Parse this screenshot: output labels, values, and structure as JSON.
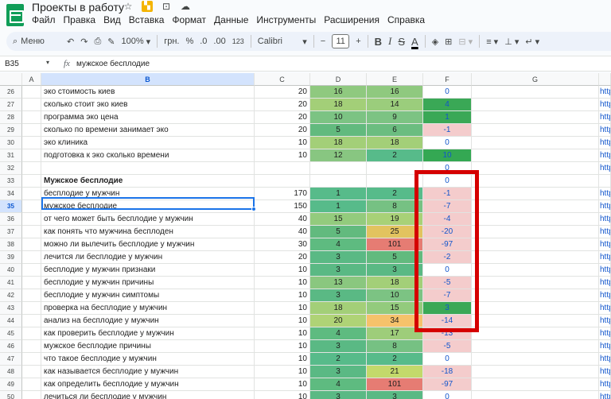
{
  "app": {
    "title": "Проекты в работу",
    "menu": [
      "Файл",
      "Правка",
      "Вид",
      "Вставка",
      "Формат",
      "Данные",
      "Инструменты",
      "Расширения",
      "Справка"
    ]
  },
  "toolbar": {
    "search_label": "Меню",
    "zoom": "100%",
    "currency": "грн.",
    "percent": "%",
    "dec_less": ".0",
    "dec_more": ".00",
    "format_123": "123",
    "font": "Calibri",
    "font_size": "11",
    "bold": "B",
    "italic": "I",
    "strike": "S",
    "text_color": "A"
  },
  "formula_bar": {
    "cell_ref": "B35",
    "fx": "fx",
    "value": "мужское бесплодие"
  },
  "columns": [
    "A",
    "B",
    "C",
    "D",
    "E",
    "F",
    "G"
  ],
  "selected_column": "B",
  "selected_row": "35",
  "rows": [
    {
      "num": "26",
      "b": "эко стоимость киев",
      "c": "20",
      "d": "16",
      "e": "16",
      "f": "0",
      "h": "http",
      "dc": "#8fc97f",
      "ec": "#8fc97f",
      "fc": ""
    },
    {
      "num": "27",
      "b": "сколько стоит эко киев",
      "c": "20",
      "d": "18",
      "e": "14",
      "f": "4",
      "h": "http",
      "dc": "#a3cf78",
      "ec": "#9bcd7c",
      "fc": "#3aa856"
    },
    {
      "num": "28",
      "b": "программа эко цена",
      "c": "20",
      "d": "10",
      "e": "9",
      "f": "1",
      "h": "http",
      "dc": "#7cc383",
      "ec": "#7cc383",
      "fc": "#3aa856"
    },
    {
      "num": "29",
      "b": "сколько по времени занимает эко",
      "c": "20",
      "d": "5",
      "e": "6",
      "f": "-1",
      "h": "http",
      "dc": "#62ba7e",
      "ec": "#6bbd80",
      "fc": "#f4cccc"
    },
    {
      "num": "30",
      "b": "эко клиника",
      "c": "10",
      "d": "18",
      "e": "18",
      "f": "0",
      "h": "http",
      "dc": "#a3cf78",
      "ec": "#a3cf78",
      "fc": ""
    },
    {
      "num": "31",
      "b": "подготовка к эко сколько времени",
      "c": "10",
      "d": "12",
      "e": "2",
      "f": "10",
      "h": "http",
      "dc": "#88c681",
      "ec": "#57bb8a",
      "fc": "#34a853"
    },
    {
      "num": "32",
      "b": "",
      "c": "",
      "d": "",
      "e": "",
      "f": "0",
      "h": "http",
      "dc": "",
      "ec": "",
      "fc": ""
    },
    {
      "num": "33",
      "b": "Мужское бесплодие",
      "bold": true,
      "c": "",
      "d": "",
      "e": "",
      "f": "0",
      "h": "",
      "dc": "",
      "ec": "",
      "fc": ""
    },
    {
      "num": "34",
      "b": "бесплодие у мужчин",
      "c": "170",
      "d": "1",
      "e": "2",
      "f": "-1",
      "h": "http",
      "dc": "#57bb8a",
      "ec": "#57bb8a",
      "fc": "#f4cccc"
    },
    {
      "num": "35",
      "b": "мужское бесплодие",
      "c": "150",
      "d": "1",
      "e": "8",
      "f": "-7",
      "h": "http",
      "dc": "#57bb8a",
      "ec": "#76c183",
      "fc": "#f4cccc"
    },
    {
      "num": "36",
      "b": "от чего может быть бесплодие у мужчин",
      "c": "40",
      "d": "15",
      "e": "19",
      "f": "-4",
      "h": "http",
      "dc": "#93cb7d",
      "ec": "#a8d177",
      "fc": "#f4cccc"
    },
    {
      "num": "37",
      "b": "как понять что мужчина бесплоден",
      "c": "40",
      "d": "5",
      "e": "25",
      "f": "-20",
      "h": "http",
      "dc": "#62ba7e",
      "ec": "#e2c35f",
      "fc": "#f4cccc"
    },
    {
      "num": "38",
      "b": "можно ли вылечить бесплодие у мужчин",
      "c": "30",
      "d": "4",
      "e": "101",
      "f": "-97",
      "h": "http",
      "dc": "#5ebb80",
      "ec": "#e67c73",
      "fc": "#f4cccc"
    },
    {
      "num": "39",
      "b": "лечится ли бесплодие у мужчин",
      "c": "20",
      "d": "3",
      "e": "5",
      "f": "-2",
      "h": "http",
      "dc": "#5ab984",
      "ec": "#62ba7e",
      "fc": "#f4cccc"
    },
    {
      "num": "40",
      "b": "бесплодие у мужчин признаки",
      "c": "10",
      "d": "3",
      "e": "3",
      "f": "0",
      "h": "http",
      "dc": "#5ab984",
      "ec": "#5ab984",
      "fc": ""
    },
    {
      "num": "41",
      "b": "бесплодие у мужчин причины",
      "c": "10",
      "d": "13",
      "e": "18",
      "f": "-5",
      "h": "http",
      "dc": "#8ac77f",
      "ec": "#a3cf78",
      "fc": "#f4cccc"
    },
    {
      "num": "42",
      "b": "бесплодие у мужчин симптомы",
      "c": "10",
      "d": "3",
      "e": "10",
      "f": "-7",
      "h": "http",
      "dc": "#5ab984",
      "ec": "#7cc383",
      "fc": "#f4cccc"
    },
    {
      "num": "43",
      "b": "проверка на бесплодие у мужчин",
      "c": "10",
      "d": "18",
      "e": "15",
      "f": "3",
      "h": "http",
      "dc": "#a3cf78",
      "ec": "#93cb7d",
      "fc": "#3aa856"
    },
    {
      "num": "44",
      "b": "анализ на бесплодие у мужчин",
      "c": "10",
      "d": "20",
      "e": "34",
      "f": "-14",
      "h": "http",
      "dc": "#afd376",
      "ec": "#f6c26b",
      "fc": "#f4cccc"
    },
    {
      "num": "45",
      "b": "как проверить бесплодие у мужчин",
      "c": "10",
      "d": "4",
      "e": "17",
      "f": "-13",
      "h": "http",
      "dc": "#5ebb80",
      "ec": "#9ecd7a",
      "fc": "#f4cccc"
    },
    {
      "num": "46",
      "b": "мужское бесплодие причины",
      "c": "10",
      "d": "3",
      "e": "8",
      "f": "-5",
      "h": "http",
      "dc": "#5ab984",
      "ec": "#76c183",
      "fc": "#f4cccc"
    },
    {
      "num": "47",
      "b": "что такое бесплодие у мужчин",
      "c": "10",
      "d": "2",
      "e": "2",
      "f": "0",
      "h": "http",
      "dc": "#57bb8a",
      "ec": "#57bb8a",
      "fc": ""
    },
    {
      "num": "48",
      "b": "как называется бесплодие у мужчин",
      "c": "10",
      "d": "3",
      "e": "21",
      "f": "-18",
      "h": "http",
      "dc": "#5ab984",
      "ec": "#c3d96b",
      "fc": "#f4cccc"
    },
    {
      "num": "49",
      "b": "как определить бесплодие у мужчин",
      "c": "10",
      "d": "4",
      "e": "101",
      "f": "-97",
      "h": "http",
      "dc": "#5ebb80",
      "ec": "#e67c73",
      "fc": "#f4cccc"
    },
    {
      "num": "50",
      "b": "лечиться ли бесплодие у мужчин",
      "c": "10",
      "d": "3",
      "e": "3",
      "f": "0",
      "h": "http",
      "dc": "#5ab984",
      "ec": "#5ab984",
      "fc": ""
    }
  ]
}
